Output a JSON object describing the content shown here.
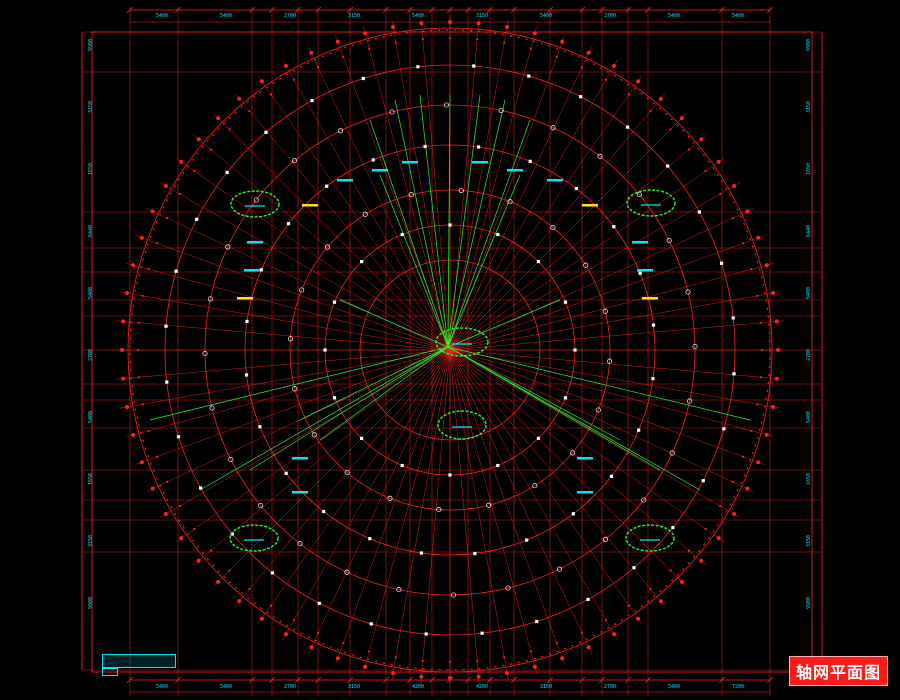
{
  "drawing": {
    "title": "轴网平面图",
    "colors": {
      "grid": "#ff2020",
      "ray_highlight": "#22ff22",
      "dimension": "#00e5ff",
      "marker": "#ffffff",
      "cloud": "#22ff22",
      "tag": "#ffe600",
      "background": "#000000"
    },
    "top_dimensions": [
      "5400",
      "5400",
      "2700",
      "3150",
      "5400",
      "3150",
      "5400",
      "2700",
      "5400",
      "5400"
    ],
    "bottom_dimensions": [
      "5400",
      "5400",
      "2700",
      "3150",
      "4200",
      "4200",
      "3150",
      "2700",
      "5400",
      "7200"
    ],
    "side_dimensions": [
      "9900",
      "3150",
      "1650",
      "6440",
      "5400",
      "2700",
      "5400",
      "1650",
      "3150",
      "9900"
    ]
  }
}
